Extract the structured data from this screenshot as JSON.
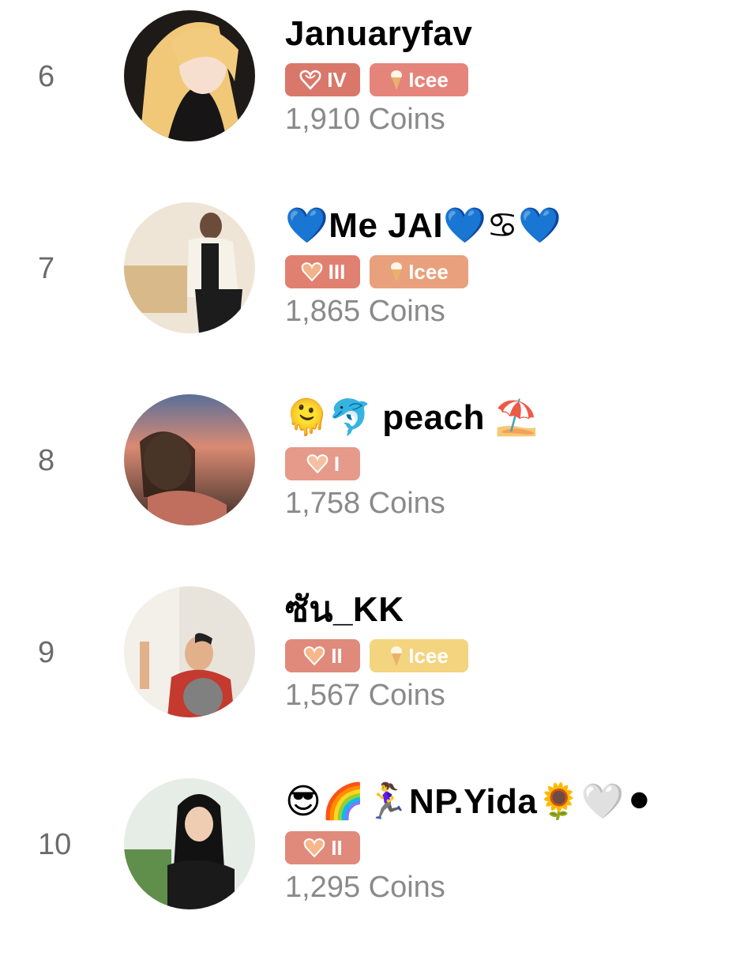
{
  "leaderboard": {
    "rows": [
      {
        "rank": "6",
        "name": "Januaryfav",
        "level": "IV",
        "level_color": "#d9776b",
        "has_icee": true,
        "icee_label": "Icee",
        "icee_color": "#e5847a",
        "coins": "1,910 Coins"
      },
      {
        "rank": "7",
        "name": "💙Me JAI💙♋💙",
        "level": "III",
        "level_color": "#e08070",
        "has_icee": true,
        "icee_label": "Icee",
        "icee_color": "#e9a07c",
        "coins": "1,865 Coins"
      },
      {
        "rank": "8",
        "name": "🫠🐬 peach ⛱️",
        "level": "I",
        "level_color": "#e69a8a",
        "has_icee": false,
        "icee_label": "",
        "icee_color": "",
        "coins": "1,758 Coins"
      },
      {
        "rank": "9",
        "name": "ซัน_KK",
        "level": "II",
        "level_color": "#e08a7c",
        "has_icee": true,
        "icee_label": "Icee",
        "icee_color": "#f3d47f",
        "coins": "1,567 Coins"
      },
      {
        "rank": "10",
        "name": "😎🌈🏃‍♀️NP.Yida🌻🤍⚫",
        "level": "II",
        "level_color": "#e08a7c",
        "has_icee": false,
        "icee_label": "",
        "icee_color": "",
        "coins": "1,295 Coins"
      }
    ]
  }
}
